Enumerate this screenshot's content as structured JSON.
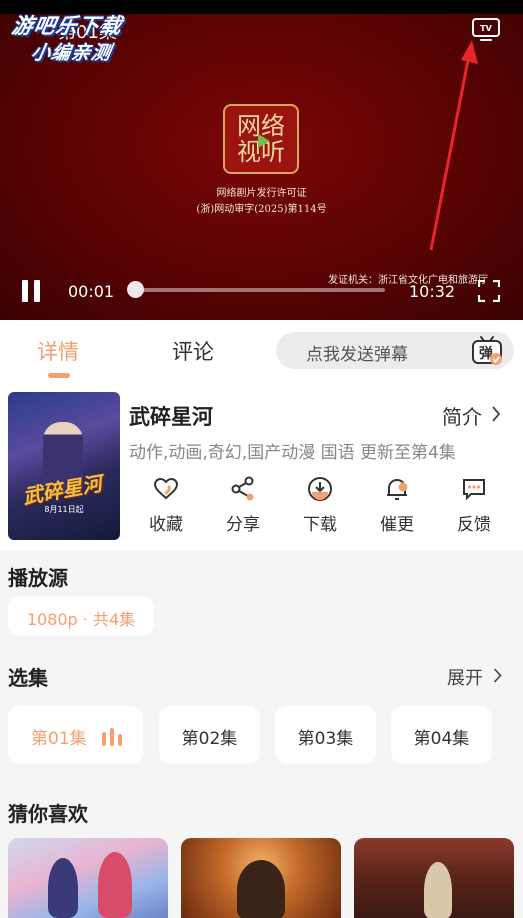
{
  "player": {
    "title": "第01集",
    "watermark": {
      "line1": "游吧乐下载",
      "line2": "小编亲测"
    },
    "seal_text": "网络视听",
    "license_title": "网络剧片发行许可证",
    "license_number": "(浙)网动审字(2025)第114号",
    "authority": "发证机关：浙江省文化广电和旅游厅",
    "current_time": "00:01",
    "total_time": "10:32",
    "progress": 0.0016,
    "icons": [
      "tv-cast-icon",
      "pause-icon",
      "fullscreen-icon"
    ]
  },
  "tabs": {
    "details": "详情",
    "comments": "评论",
    "active": "details",
    "danmu_placeholder": "点我发送弹幕",
    "danmu_icon_text": "弹"
  },
  "show": {
    "title": "武碎星河",
    "intro_label": "简介",
    "tags": "动作,动画,奇幻,国产动漫 国语 更新至第4集",
    "poster_title": "武碎星河",
    "poster_date": "8月11日起",
    "actions": [
      {
        "label": "收藏",
        "icon": "heart-icon"
      },
      {
        "label": "分享",
        "icon": "share-icon"
      },
      {
        "label": "下载",
        "icon": "download-icon"
      },
      {
        "label": "催更",
        "icon": "bell-icon"
      },
      {
        "label": "反馈",
        "icon": "feedback-icon"
      }
    ]
  },
  "source": {
    "title": "播放源",
    "selected": "1080p · 共4集"
  },
  "episodes": {
    "title": "选集",
    "expand_label": "展开",
    "items": [
      "第01集",
      "第02集",
      "第03集",
      "第04集"
    ],
    "active_index": 0
  },
  "recommend": {
    "title": "猜你喜欢"
  },
  "colors": {
    "accent": "#f5a070",
    "player_bg": "#5a0303",
    "arrow": "#e8262a"
  }
}
